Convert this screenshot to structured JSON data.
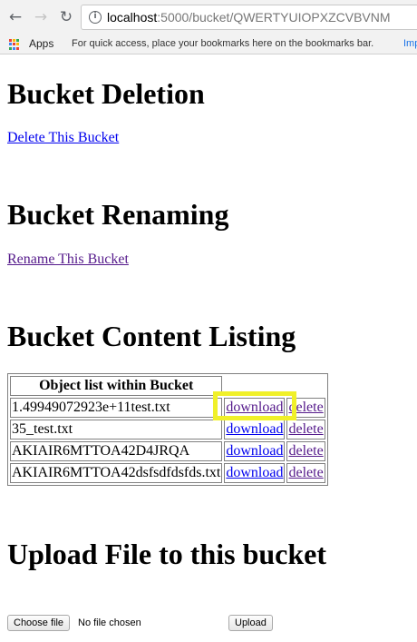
{
  "browser": {
    "url_host": "localhost",
    "url_path": ":5000/bucket/QWERTYUIOPXZCVBVNM",
    "back_glyph": "←",
    "forward_glyph": "→",
    "reload_glyph": "↻",
    "info_glyph": "i"
  },
  "bookmarks_bar": {
    "apps_label": "Apps",
    "hint": "For quick access, place your bookmarks here on the bookmarks bar.",
    "import_link": "Imp"
  },
  "sections": {
    "deletion": {
      "title": "Bucket Deletion",
      "link": "Delete This Bucket"
    },
    "renaming": {
      "title": "Bucket Renaming",
      "link": "Rename This Bucket"
    },
    "listing": {
      "title": "Bucket Content Listing",
      "table_header": "Object list within Bucket",
      "rows": [
        {
          "name": "1.49949072923e+11test.txt",
          "download": "download",
          "delete": "delete"
        },
        {
          "name": "35_test.txt",
          "download": "download",
          "delete": "delete"
        },
        {
          "name": "AKIAIR6MTTOA42D4JRQA",
          "download": "download",
          "delete": "delete"
        },
        {
          "name": "AKIAIR6MTTOA42dsfsdfdsfds.txt",
          "download": "download",
          "delete": "delete"
        }
      ]
    },
    "upload": {
      "title": "Upload File to this bucket",
      "choose_file_label": "Choose file",
      "no_file_text": "No file chosen",
      "upload_label": "Upload"
    }
  },
  "colors": {
    "link": "#0000ee",
    "visited_link": "#551a8b",
    "highlight": "#f0f02a"
  }
}
